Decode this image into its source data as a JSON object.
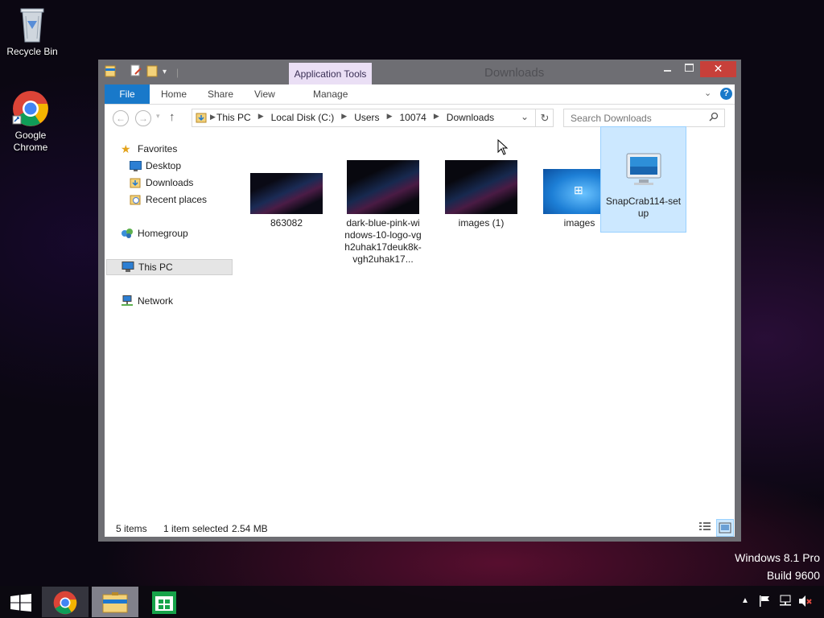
{
  "desktop": {
    "icons": [
      {
        "label": "Recycle Bin",
        "icon": "recycle-bin-icon"
      },
      {
        "label": "Google\nChrome",
        "icon": "chrome-icon"
      }
    ],
    "watermark_line1": "Windows 8.1 Pro",
    "watermark_line2": "Build 9600"
  },
  "window": {
    "title": "Downloads",
    "contextual_tab_group": "Application Tools",
    "ribbon_tabs": [
      "File",
      "Home",
      "Share",
      "View",
      "Manage"
    ],
    "address": {
      "crumbs": [
        "This PC",
        "Local Disk (C:)",
        "Users",
        "10074",
        "Downloads"
      ]
    },
    "search_placeholder": "Search Downloads",
    "nav_pane": {
      "favorites": "Favorites",
      "desktop": "Desktop",
      "downloads": "Downloads",
      "recent": "Recent places",
      "homegroup": "Homegroup",
      "this_pc": "This PC",
      "network": "Network"
    },
    "files": [
      {
        "name": "863082",
        "thumb": "dark-windows10"
      },
      {
        "name": "dark-blue-pink-windows-10-logo-vgh2uhak17deuk8k-vgh2uhak17...",
        "thumb": "dark-windows10"
      },
      {
        "name": "images (1)",
        "thumb": "dark-windows10"
      },
      {
        "name": "images",
        "thumb": "blue-windows7"
      },
      {
        "name": "SnapCrab114-setup",
        "thumb": "installer-monitor",
        "selected": true
      }
    ],
    "status": {
      "item_count": "5 items",
      "selection": "1 item selected",
      "size": "2.54 MB"
    },
    "colors": {
      "file_tab": "#1979ca",
      "selection": "#cce8ff",
      "context_tab": "#eadff5"
    }
  },
  "taskbar": {
    "apps": [
      "start-icon",
      "chrome-icon",
      "file-explorer-icon",
      "store-icon"
    ],
    "tray": [
      "show-hidden-icons-icon",
      "action-center-flag-icon",
      "network-icon",
      "volume-muted-icon"
    ]
  }
}
